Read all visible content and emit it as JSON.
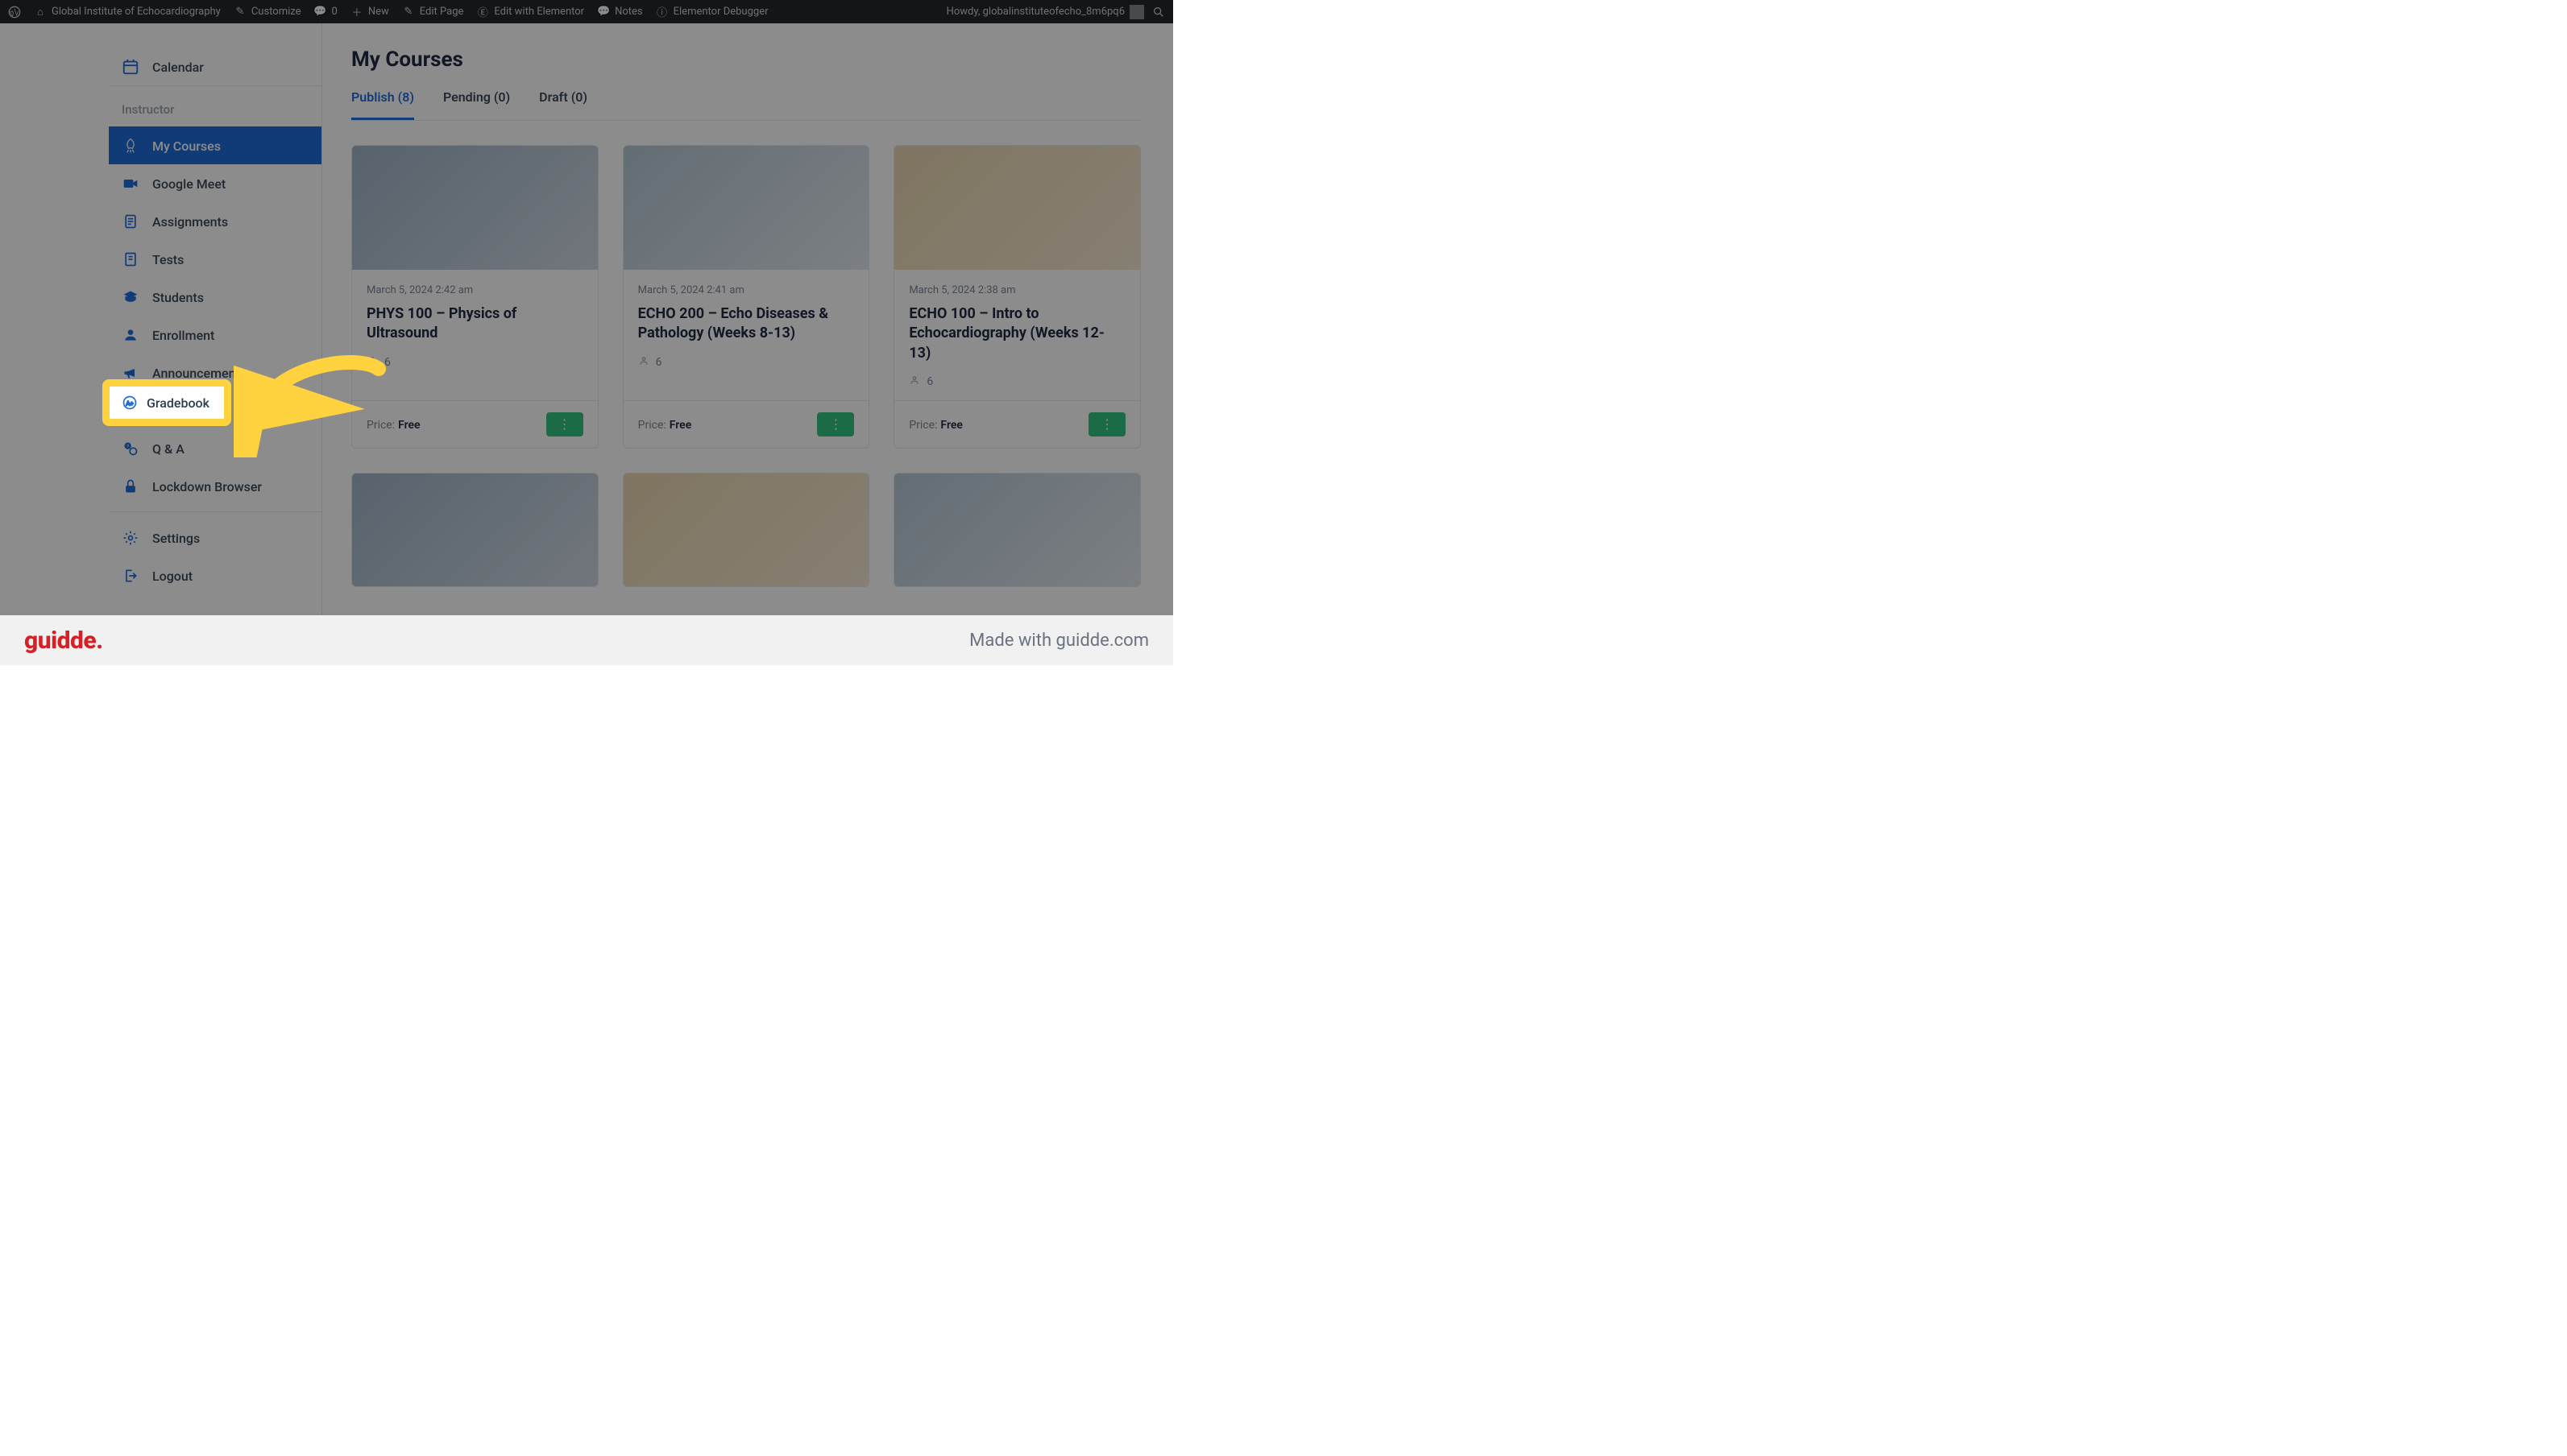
{
  "adminbar": {
    "site_name": "Global Institute of Echocardiography",
    "customize": "Customize",
    "comment_count": "0",
    "new": "New",
    "edit_page": "Edit Page",
    "edit_elementor": "Edit with Elementor",
    "notes": "Notes",
    "elementor_debugger": "Elementor Debugger",
    "howdy": "Howdy, globalinstituteofecho_8m6pq6"
  },
  "sidebar": {
    "calendar": "Calendar",
    "heading_instructor": "Instructor",
    "items": [
      {
        "label": "My Courses"
      },
      {
        "label": "Google Meet"
      },
      {
        "label": "Assignments"
      },
      {
        "label": "Tests"
      },
      {
        "label": "Students"
      },
      {
        "label": "Enrollment"
      },
      {
        "label": "Announcements"
      },
      {
        "label": "Gradebook"
      },
      {
        "label": "Q & A"
      },
      {
        "label": "Lockdown Browser"
      }
    ],
    "settings": "Settings",
    "logout": "Logout"
  },
  "main": {
    "title": "My Courses",
    "tabs": [
      {
        "label": "Publish (8)"
      },
      {
        "label": "Pending (0)"
      },
      {
        "label": "Draft (0)"
      }
    ],
    "courses": [
      {
        "date": "March 5, 2024 2:42 am",
        "title": "PHYS 100 – Physics of Ultrasound",
        "students": "6",
        "price_label": "Price:",
        "price_value": "Free"
      },
      {
        "date": "March 5, 2024 2:41 am",
        "title": "ECHO 200 – Echo Diseases & Pathology (Weeks 8-13)",
        "students": "6",
        "price_label": "Price:",
        "price_value": "Free"
      },
      {
        "date": "March 5, 2024 2:38 am",
        "title": "ECHO 100 – Intro to Echocardiography (Weeks 12-13)",
        "students": "6",
        "price_label": "Price:",
        "price_value": "Free"
      }
    ]
  },
  "guidde": {
    "logo": "guidde.",
    "credit": "Made with guidde.com"
  }
}
